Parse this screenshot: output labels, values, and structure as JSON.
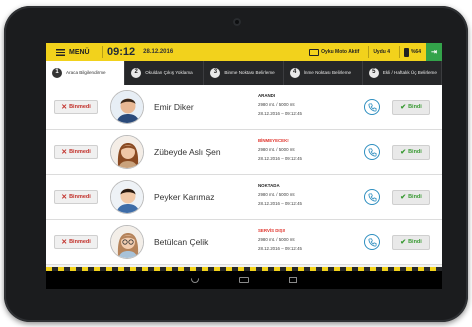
{
  "topbar": {
    "menu_label": "MENÜ",
    "time": "09:12",
    "date": "28.12.2016",
    "indicators": [
      {
        "label": "Oyku Moto Aktif",
        "icon": "monitor-icon"
      },
      {
        "label": "Uydu 4",
        "icon": "satellite-icon"
      },
      {
        "label": "%64",
        "icon": "battery-icon"
      }
    ],
    "action_icon": "green-action-icon"
  },
  "tabs": [
    {
      "num": "1",
      "label": "Araca Bilgilendirme"
    },
    {
      "num": "2",
      "label": "Okuldan Çıkış Yoklama"
    },
    {
      "num": "3",
      "label": "Binme Noktası Belirleme"
    },
    {
      "num": "4",
      "label": "İnme Noktası Belirleme"
    },
    {
      "num": "5",
      "label": "Ekli / Haftalık Üç Belirleme"
    }
  ],
  "students": [
    {
      "name": "Emir Diker",
      "status": "ARANDI",
      "status_color": "#222222",
      "distance": "2980 mt. / 5000 mt",
      "time": "28.12.2016 – 09:12:45",
      "avatar": "boy-avatar"
    },
    {
      "name": "Zübeyde Aslı Şen",
      "status": "BİNMEYECEK!",
      "status_color": "#e0342c",
      "distance": "2980 mt. / 5000 mt",
      "time": "28.12.2016 – 09:12:45",
      "avatar": "girl-avatar"
    },
    {
      "name": "Peyker Karımaz",
      "status": "NOKTADA",
      "status_color": "#222222",
      "distance": "2980 mt. / 5000 mt",
      "time": "28.12.2016 – 09:12:45",
      "avatar": "boy-avatar"
    },
    {
      "name": "Betülcan Çelik",
      "status": "SERVİS DIŞI!",
      "status_color": "#e0342c",
      "distance": "2980 mt. / 5000 mt",
      "time": "28.12.2016 – 09:12:45",
      "avatar": "girl-glasses-avatar"
    }
  ],
  "buttons": {
    "not_boarded": "Binmedi",
    "boarded": "Bindi"
  },
  "colors": {
    "accent": "#f2d21c",
    "tab_bg": "#262729",
    "danger": "#e0342c",
    "success": "#3a9a34",
    "phone": "#2f8fc0"
  }
}
